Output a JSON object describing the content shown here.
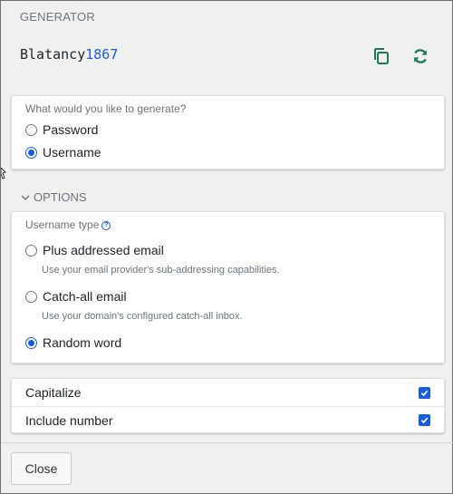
{
  "header": {
    "title": "GENERATOR",
    "generated_word": "Blatancy",
    "generated_number": "1867"
  },
  "type_selector": {
    "label": "What would you like to generate?",
    "options": [
      {
        "label": "Password",
        "selected": false
      },
      {
        "label": "Username",
        "selected": true
      }
    ]
  },
  "options": {
    "toggle_label": "OPTIONS",
    "username_type_label": "Username type",
    "types": [
      {
        "label": "Plus addressed email",
        "hint": "Use your email provider's sub-addressing capabilities.",
        "selected": false
      },
      {
        "label": "Catch-all email",
        "hint": "Use your domain's configured catch-all inbox.",
        "selected": false
      },
      {
        "label": "Random word",
        "hint": "",
        "selected": true
      }
    ]
  },
  "checks": [
    {
      "label": "Capitalize",
      "checked": true
    },
    {
      "label": "Include number",
      "checked": true
    }
  ],
  "footer": {
    "close_label": "Close"
  },
  "colors": {
    "accent": "#175ddc",
    "icon_green": "#1f7a52"
  },
  "icons": {
    "copy": "copy-icon",
    "regenerate": "refresh-icon",
    "help": "question-circle-icon",
    "chevron": "chevron-down-icon"
  }
}
